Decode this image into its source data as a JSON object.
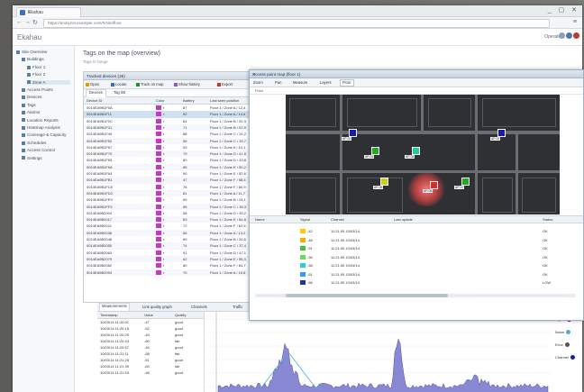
{
  "browser": {
    "tab_title": "Ekahau",
    "url": "https://analyzer.example.com/#/site/floor",
    "window_controls": "_ ▢ ✕"
  },
  "app": {
    "title": "Ekahau",
    "user_label": "Operator",
    "user_icons": [
      "#8aa0b8",
      "#4a76a8",
      "#c0392b"
    ]
  },
  "sidebar": {
    "items": [
      {
        "label": "Site Overview",
        "indent": 0
      },
      {
        "label": "Buildings",
        "indent": 1
      },
      {
        "label": "Floor 1",
        "indent": 2
      },
      {
        "label": "Floor 2",
        "indent": 2
      },
      {
        "label": "Zone A",
        "indent": 2
      },
      {
        "label": "Access Points",
        "indent": 1
      },
      {
        "label": "Devices",
        "indent": 1
      },
      {
        "label": "Tags",
        "indent": 1
      },
      {
        "label": "Alarms",
        "indent": 1
      },
      {
        "label": "Location Reports",
        "indent": 1
      },
      {
        "label": "Heatmap Analysis",
        "indent": 1
      },
      {
        "label": "Coverage & Capacity",
        "indent": 1
      },
      {
        "label": "Schedules",
        "indent": 1
      },
      {
        "label": "Access Control",
        "indent": 1
      },
      {
        "label": "Settings",
        "indent": 1
      }
    ]
  },
  "main": {
    "title": "Tags on the map (overview)",
    "subtitle": "Tags in range",
    "panel_title": "Tracked devices (36)",
    "toolbar": [
      "Open",
      "Locate",
      "Track on map",
      "Show history",
      "Export"
    ],
    "tabs": [
      "Devices",
      "Tag list"
    ],
    "columns": [
      "Device ID",
      "Color",
      "Battery",
      "Last seen position"
    ],
    "rows": [
      {
        "id": "0014EA9B1F0A",
        "color": "#cc33cc",
        "battery": "87",
        "pos": "Floor 1 / Zone A / 12,4"
      },
      {
        "id": "0014EA9B1F11",
        "color": "#cc33cc",
        "battery": "92",
        "pos": "Floor 1 / Zone A / 14,6"
      },
      {
        "id": "0014EA9B1F2C",
        "color": "#cc33cc",
        "battery": "64",
        "pos": "Floor 1 / Zone B / 20,3"
      },
      {
        "id": "0014EA9B1F31",
        "color": "#cc33cc",
        "battery": "71",
        "pos": "Floor 1 / Zone B / 22,9"
      },
      {
        "id": "0014EA9B1F45",
        "color": "#cc33cc",
        "battery": "88",
        "pos": "Floor 1 / Zone C / 31,2"
      },
      {
        "id": "0014EA9B1F52",
        "color": "#cc33cc",
        "battery": "55",
        "pos": "Floor 1 / Zone C / 33,7"
      },
      {
        "id": "0014EA9B1F67",
        "color": "#cc33cc",
        "battery": "93",
        "pos": "Floor 1 / Zone A / 10,1"
      },
      {
        "id": "0014EA9B1F70",
        "color": "#cc33cc",
        "battery": "79",
        "pos": "Floor 1 / Zone D / 41,5"
      },
      {
        "id": "0014EA9B1F83",
        "color": "#cc33cc",
        "battery": "60",
        "pos": "Floor 1 / Zone D / 43,8"
      },
      {
        "id": "0014EA9B1F9A",
        "color": "#cc33cc",
        "battery": "85",
        "pos": "Floor 1 / Zone E / 50,2"
      },
      {
        "id": "0014EA9B1FA4",
        "color": "#cc33cc",
        "battery": "90",
        "pos": "Floor 1 / Zone E / 52,6"
      },
      {
        "id": "0014EA9B1FB1",
        "color": "#cc33cc",
        "battery": "47",
        "pos": "Floor 1 / Zone F / 58,4"
      },
      {
        "id": "0014EA9B1FC8",
        "color": "#cc33cc",
        "battery": "76",
        "pos": "Floor 1 / Zone F / 60,9"
      },
      {
        "id": "0014EA9B1FD2",
        "color": "#cc33cc",
        "battery": "81",
        "pos": "Floor 1 / Zone A / 11,7"
      },
      {
        "id": "0014EA9B1FE9",
        "color": "#cc33cc",
        "battery": "69",
        "pos": "Floor 1 / Zone B / 24,1"
      },
      {
        "id": "0014EA9B1FF3",
        "color": "#cc33cc",
        "battery": "95",
        "pos": "Floor 1 / Zone C / 35,3"
      },
      {
        "id": "0014EA9B2004",
        "color": "#cc33cc",
        "battery": "58",
        "pos": "Floor 1 / Zone D / 45,2"
      },
      {
        "id": "0014EA9B2017",
        "color": "#cc33cc",
        "battery": "83",
        "pos": "Floor 1 / Zone E / 54,8"
      },
      {
        "id": "0014EA9B2021",
        "color": "#cc33cc",
        "battery": "72",
        "pos": "Floor 1 / Zone F / 62,5"
      },
      {
        "id": "0014EA9B2036",
        "color": "#cc33cc",
        "battery": "66",
        "pos": "Floor 1 / Zone A / 13,2"
      },
      {
        "id": "0014EA9B2048",
        "color": "#cc33cc",
        "battery": "89",
        "pos": "Floor 1 / Zone B / 26,6"
      },
      {
        "id": "0014EA9B2055",
        "color": "#cc33cc",
        "battery": "74",
        "pos": "Floor 1 / Zone C / 37,4"
      },
      {
        "id": "0014EA9B2063",
        "color": "#cc33cc",
        "battery": "91",
        "pos": "Floor 1 / Zone D / 47,1"
      },
      {
        "id": "0014EA9B2079",
        "color": "#cc33cc",
        "battery": "62",
        "pos": "Floor 1 / Zone E / 56,3"
      },
      {
        "id": "0014EA9B2082",
        "color": "#cc33cc",
        "battery": "80",
        "pos": "Floor 1 / Zone F / 64,7"
      },
      {
        "id": "0014EA9B2094",
        "color": "#cc33cc",
        "battery": "70",
        "pos": "Floor 1 / Zone A / 15,8"
      }
    ]
  },
  "popup": {
    "title": "Access point map (floor 1)",
    "toolbar": [
      "Zoom",
      "Pan",
      "Measure",
      "Layers",
      "Floor"
    ],
    "active_tool": "Floor",
    "sub_label": "Floor",
    "access_points": [
      {
        "label": "AP-01",
        "color": "#1a1aa8"
      },
      {
        "label": "AP-02",
        "color": "#1a1aa8"
      },
      {
        "label": "AP-03",
        "color": "#22aa22"
      },
      {
        "label": "AP-04",
        "color": "#22cc99"
      },
      {
        "label": "AP-05",
        "color": "#cccc22"
      },
      {
        "label": "AP-06",
        "color": "#d03030"
      },
      {
        "label": "AP-07",
        "color": "#22aa22"
      }
    ],
    "table_columns": [
      "Name",
      "Signal",
      "Channel",
      "Last update",
      "Status"
    ],
    "table_rows": [
      {
        "color": "#ffcc00",
        "name": "AP-01",
        "signal": "-42",
        "channel": "11:21:05 10/03/14",
        "status": "OK"
      },
      {
        "color": "#ffaa00",
        "name": "AP-02",
        "signal": "-48",
        "channel": "11:21:05 10/03/14",
        "status": "OK"
      },
      {
        "color": "#33cc33",
        "name": "AP-03",
        "signal": "-51",
        "channel": "11:21:05 10/03/14",
        "status": "OK"
      },
      {
        "color": "#66dd66",
        "name": "AP-04",
        "signal": "-55",
        "channel": "11:21:05 10/03/14",
        "status": "OK"
      },
      {
        "color": "#33cccc",
        "name": "AP-05",
        "signal": "-58",
        "channel": "11:21:05 10/03/14",
        "status": "OK"
      },
      {
        "color": "#3399ff",
        "name": "AP-06",
        "signal": "-61",
        "channel": "11:21:05 10/03/14",
        "status": "OK"
      },
      {
        "color": "#2233aa",
        "name": "AP-07",
        "signal": "-66",
        "channel": "11:21:05 10/03/14",
        "status": "LOW"
      }
    ]
  },
  "bottom": {
    "tabs": [
      "Measurements",
      "Link quality graph",
      "Channels",
      "Traffic"
    ],
    "list_columns": [
      "Timestamp",
      "Value",
      "Quality"
    ],
    "list_rows": [
      {
        "time": "10/03/14 11:20:01",
        "value": "-47",
        "q": "good"
      },
      {
        "time": "10/03/14 11:20:15",
        "value": "-52",
        "q": "good"
      },
      {
        "time": "10/03/14 11:20:29",
        "value": "-49",
        "q": "good"
      },
      {
        "time": "10/03/14 11:20:43",
        "value": "-60",
        "q": "fair"
      },
      {
        "time": "10/03/14 11:20:57",
        "value": "-45",
        "q": "good"
      },
      {
        "time": "10/03/14 11:21:11",
        "value": "-58",
        "q": "fair"
      },
      {
        "time": "10/03/14 11:21:25",
        "value": "-51",
        "q": "good"
      },
      {
        "time": "10/03/14 11:21:39",
        "value": "-63",
        "q": "fair"
      },
      {
        "time": "10/03/14 11:21:53",
        "value": "-48",
        "q": "good"
      }
    ],
    "chart_label": "Signal",
    "legend": [
      {
        "label": "Signal",
        "color": "#1a1aa8"
      },
      {
        "label": "Noise",
        "color": "#55aadd"
      },
      {
        "label": "Error",
        "color": "#555555"
      },
      {
        "label": "Channel",
        "color": "#1a1aa8"
      }
    ]
  },
  "colors": {
    "accent": "#3b6fb6",
    "tag_magenta": "#cc33cc",
    "chart_fill": "#6a6ac8"
  }
}
